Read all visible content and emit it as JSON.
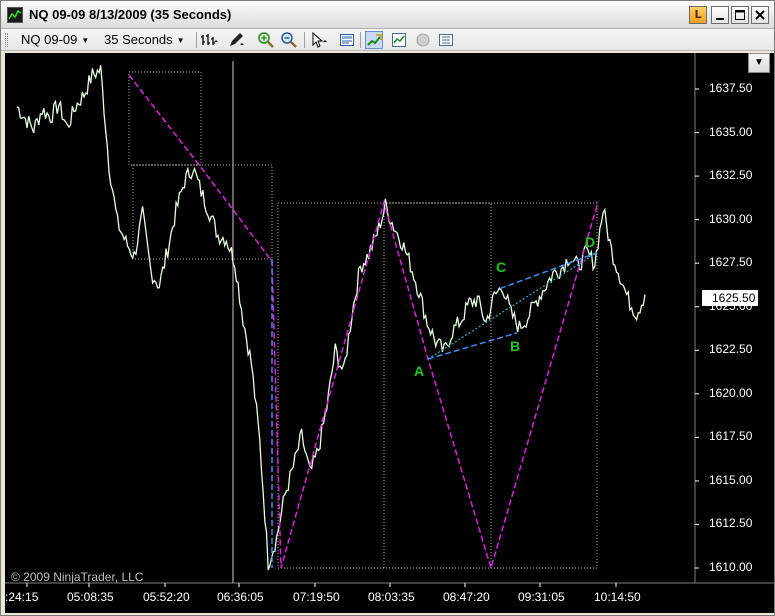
{
  "window": {
    "title": "NQ 09-09  8/13/2009 (35 Seconds)",
    "link_button": "L"
  },
  "toolbar": {
    "instrument": "NQ 09-09",
    "interval": "35 Seconds",
    "icons": [
      "bar-style-icon",
      "drawing-pencil-icon",
      "zoom-in-icon",
      "zoom-out-icon",
      "cursor-icon",
      "data-box-icon",
      "strategy-icon",
      "indicators-icon",
      "disabled-circle-icon",
      "properties-icon"
    ]
  },
  "chart": {
    "copyright": "© 2009 NinjaTrader, LLC",
    "current_price": "1625.50",
    "y_ticks": [
      "1637.50",
      "1635.00",
      "1632.50",
      "1630.00",
      "1627.50",
      "1625.00",
      "1622.50",
      "1620.00",
      "1617.50",
      "1615.00",
      "1612.50",
      "1610.00"
    ],
    "x_ticks": [
      ":24:15",
      "05:08:35",
      "05:52:20",
      "06:36:05",
      "07:19:50",
      "08:03:35",
      "08:47:20",
      "09:31:05",
      "10:14:50"
    ],
    "pattern_labels": {
      "A": "A",
      "B": "B",
      "C": "C",
      "D": "D"
    },
    "colors": {
      "background": "#000000",
      "price": "#e6ffe0",
      "zigzag": "#e020e0",
      "abcd": "#3c8cf0",
      "label": "#1ec81e"
    }
  },
  "chart_data": {
    "type": "line",
    "x_ticks": [
      ":24:15",
      "05:08:35",
      "05:52:20",
      "06:36:05",
      "07:19:50",
      "08:03:35",
      "08:47:20",
      "09:31:05",
      "10:14:50"
    ],
    "ylim": [
      1609,
      1641
    ],
    "series": [
      {
        "values": [
          1636.5,
          1635.8,
          1635.2,
          1636.3,
          1635.9,
          1636.6,
          1635.3,
          1636.5,
          1637.2,
          1638.3,
          1638.6,
          1633.1,
          1629.8,
          1628.7,
          1627.9,
          1630.3,
          1627.0,
          1626.2,
          1628.3,
          1630.5,
          1632.2,
          1633.0,
          1631.6,
          1630.4,
          1629.1,
          1628.9,
          1627.6,
          1624.3,
          1621.7,
          1617.2,
          1610.3,
          1611.7,
          1614.2,
          1615.8,
          1617.6,
          1615.4,
          1616.8,
          1619.2,
          1622.5,
          1621.2,
          1624.6,
          1627.3,
          1628.0,
          1629.2,
          1630.8,
          1629.6,
          1628.7,
          1627.4,
          1625.9,
          1624.1,
          1623.0,
          1622.4,
          1623.6,
          1624.2,
          1625.2,
          1625.4,
          1624.1,
          1625.6,
          1626.2,
          1624.6,
          1623.8,
          1624.4,
          1625.3,
          1626.1,
          1626.9,
          1627.2,
          1627.9,
          1627.3,
          1628.1,
          1627.5,
          1630.6,
          1628.2,
          1626.8,
          1625.4,
          1624.6,
          1625.7
        ]
      }
    ],
    "pattern_points": [
      {
        "label": "A",
        "value": 1622.0
      },
      {
        "label": "B",
        "value": 1623.5
      },
      {
        "label": "C",
        "value": 1626.5
      },
      {
        "label": "D",
        "value": 1628.1
      }
    ]
  }
}
